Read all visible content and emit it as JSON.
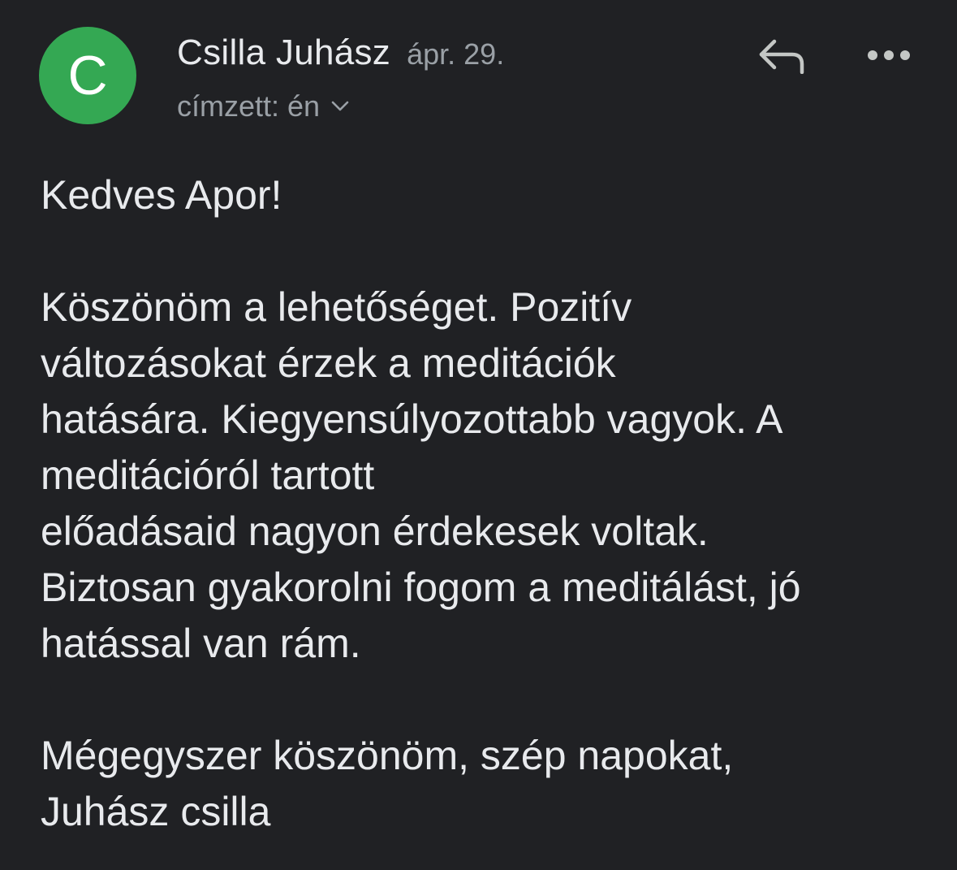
{
  "message": {
    "avatar_letter": "C",
    "avatar_color": "#34a853",
    "sender_name": "Csilla Juhász",
    "date": "ápr. 29.",
    "recipient_label": "címzett: én",
    "icons": {
      "reply": "reply-icon",
      "more": "more-horizontal-icon",
      "expand": "chevron-down-icon"
    },
    "body": {
      "greeting": "Kedves Apor!",
      "paragraph_lines": [
        "Köszönöm a lehetőséget. Pozitív",
        "változásokat érzek a meditációk",
        "hatására. Kiegyensúlyozottabb vagyok. A",
        "meditációról tartott",
        "előadásaid nagyon érdekesek voltak.",
        "Biztosan gyakorolni fogom a meditálást, jó",
        "hatással van rám."
      ],
      "closing": "Mégegyszer köszönöm, szép napokat,",
      "signature": "Juhász csilla"
    }
  }
}
